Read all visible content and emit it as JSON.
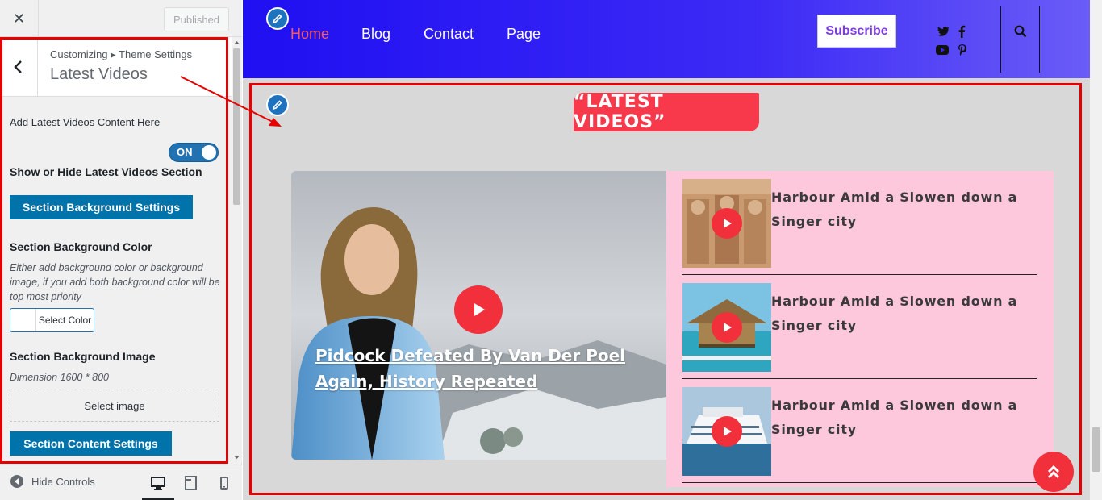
{
  "customizer": {
    "close_icon": "close-icon",
    "published_label": "Published",
    "breadcrumb": "Customizing ▸ Theme Settings",
    "section_title": "Latest Videos",
    "add_content_label": "Add Latest Videos Content Here",
    "toggle_label": "ON",
    "toggle_state": true,
    "show_hide_label": "Show or Hide Latest Videos Section",
    "bg_settings_button": "Section Background Settings",
    "bg_color_label": "Section Background Color",
    "bg_color_desc": "Either add background color or background image, if you add both background color will be top most priority",
    "select_color_label": "Select Color",
    "bg_image_label": "Section Background Image",
    "dimension_text": "Dimension 1600 * 800",
    "select_image_label": "Select image",
    "content_settings_button": "Section Content Settings",
    "hide_controls_label": "Hide Controls",
    "devices": [
      "desktop-icon",
      "tablet-icon",
      "mobile-icon"
    ]
  },
  "site": {
    "nav": [
      "Home",
      "Blog",
      "Contact",
      "Page"
    ],
    "subscribe_label": "Subscribe",
    "social_icons": [
      "twitter-icon",
      "facebook-icon",
      "youtube-icon",
      "pinterest-icon"
    ],
    "search_icon": "search-icon",
    "latest_videos_heading": "“LATEST VIDEOS”",
    "featured_title": "Pidcock Defeated By Van Der Poel Again, History Repeated",
    "videos": [
      {
        "title": "Harbour Amid a Slowen down a Singer city"
      },
      {
        "title": "Harbour Amid a Slowen down a Singer city"
      },
      {
        "title": "Harbour Amid a Slowen down a Singer city"
      }
    ]
  },
  "colors": {
    "accent_red": "#f1303c",
    "header_blue": "#1f0ff2",
    "list_pink": "#fec8dc",
    "wp_blue": "#0073aa",
    "highlight_red": "#e60000"
  }
}
